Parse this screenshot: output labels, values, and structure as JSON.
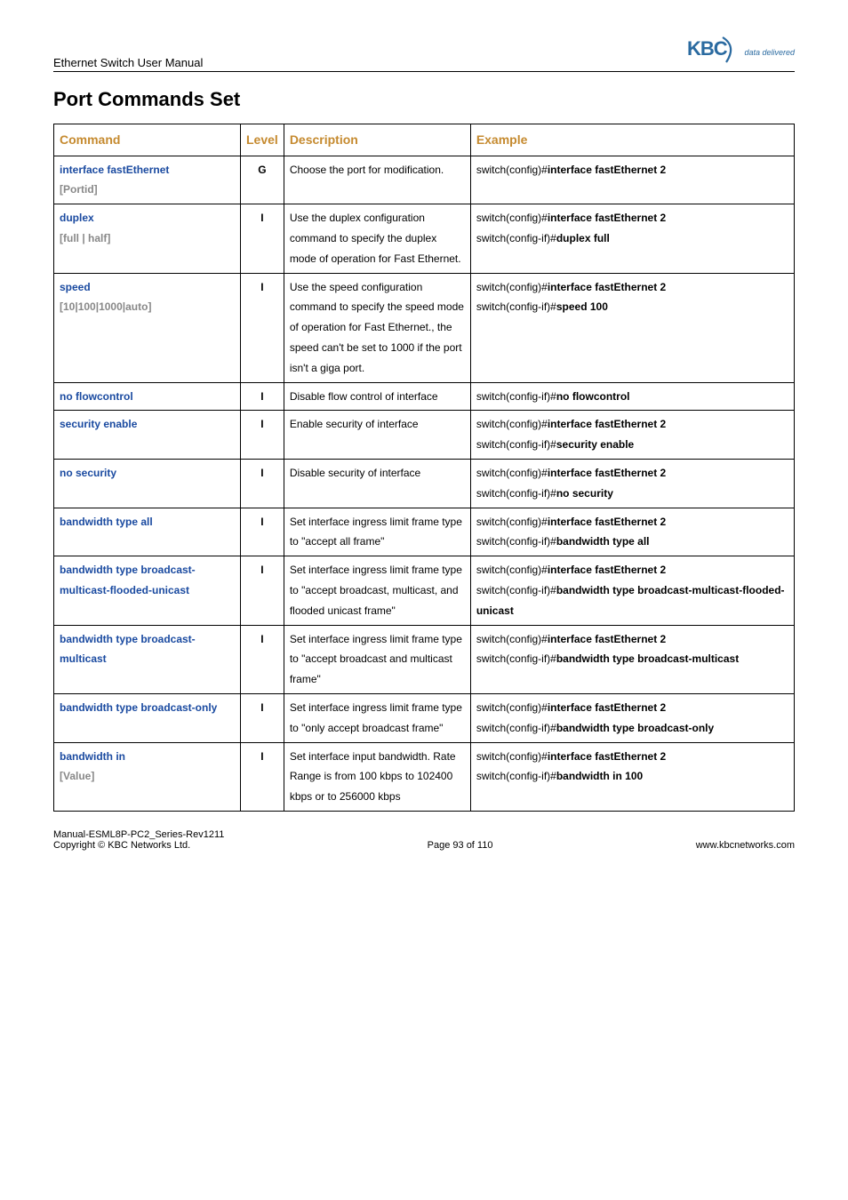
{
  "header": {
    "doc_title": "Ethernet Switch User Manual",
    "logo_tagline": "data delivered"
  },
  "section_title": "Port Commands Set",
  "table": {
    "headers": {
      "command": "Command",
      "level": "Level",
      "description": "Description",
      "example": "Example"
    },
    "rows": [
      {
        "cmd_main": "interface fastEthernet",
        "cmd_sub": "[Portid]",
        "level": "G",
        "desc": "Choose the port for modification.",
        "ex_lines": [
          {
            "pfx": "switch(config)#",
            "bold": "interface fastEthernet 2"
          }
        ]
      },
      {
        "cmd_main": "duplex",
        "cmd_sub": "[full | half]",
        "level": "I",
        "desc": "Use the duplex configuration command to specify the duplex mode of operation for Fast Ethernet.",
        "ex_lines": [
          {
            "pfx": "switch(config)#",
            "bold": "interface fastEthernet 2"
          },
          {
            "pfx": "switch(config-if)#",
            "bold": "duplex full"
          }
        ]
      },
      {
        "cmd_main": "speed",
        "cmd_sub": "[10|100|1000|auto]",
        "level": "I",
        "desc": "Use the speed configuration command to specify the speed mode of operation for Fast Ethernet., the speed can't be set to 1000 if the port isn't a giga port.",
        "ex_lines": [
          {
            "pfx": "switch(config)#",
            "bold": "interface fastEthernet 2"
          },
          {
            "pfx": "switch(config-if)#",
            "bold": "speed 100"
          }
        ]
      },
      {
        "cmd_main": "no flowcontrol",
        "cmd_sub": "",
        "level": "I",
        "desc": "Disable flow control of interface",
        "ex_lines": [
          {
            "pfx": "switch(config-if)#",
            "bold": "no flowcontrol"
          }
        ]
      },
      {
        "cmd_main": "security enable",
        "cmd_sub": "",
        "level": "I",
        "desc": "Enable security of interface",
        "ex_lines": [
          {
            "pfx": "switch(config)#",
            "bold": "interface fastEthernet 2"
          },
          {
            "pfx": "switch(config-if)#",
            "bold": "security enable"
          }
        ]
      },
      {
        "cmd_main": "no security",
        "cmd_sub": "",
        "level": "I",
        "desc": "Disable security of interface",
        "ex_lines": [
          {
            "pfx": "switch(config)#",
            "bold": "interface fastEthernet 2"
          },
          {
            "pfx": "switch(config-if)#",
            "bold": "no security"
          }
        ]
      },
      {
        "cmd_main": "bandwidth type all",
        "cmd_sub": "",
        "level": "I",
        "desc": "Set interface ingress limit frame type to \"accept all frame\"",
        "ex_lines": [
          {
            "pfx": "switch(config)#",
            "bold": "interface fastEthernet 2"
          },
          {
            "pfx": "switch(config-if)#",
            "bold": "bandwidth type all"
          }
        ]
      },
      {
        "cmd_main": "bandwidth type broadcast-multicast-flooded-unicast",
        "cmd_sub": "",
        "level": "I",
        "desc": "Set interface ingress limit frame type to \"accept broadcast, multicast, and flooded unicast frame\"",
        "ex_lines": [
          {
            "pfx": "switch(config)#",
            "bold": "interface fastEthernet 2"
          },
          {
            "pfx": "switch(config-if)#",
            "bold": "bandwidth type broadcast-multicast-flooded-unicast"
          }
        ]
      },
      {
        "cmd_main": "bandwidth type broadcast-multicast",
        "cmd_sub": "",
        "level": "I",
        "desc": "Set interface ingress limit frame type to \"accept broadcast and multicast frame\"",
        "ex_lines": [
          {
            "pfx": "switch(config)#",
            "bold": "interface fastEthernet 2"
          },
          {
            "pfx": "switch(config-if)#",
            "bold": "bandwidth type broadcast-multicast"
          }
        ]
      },
      {
        "cmd_main": "bandwidth type broadcast-only",
        "cmd_sub": "",
        "level": "I",
        "desc": "Set interface ingress limit frame type to \"only accept broadcast frame\"",
        "ex_lines": [
          {
            "pfx": "switch(config)#",
            "bold": "interface fastEthernet 2"
          },
          {
            "pfx": "switch(config-if)#",
            "bold": "bandwidth type broadcast-only"
          }
        ]
      },
      {
        "cmd_main": "bandwidth in",
        "cmd_sub": "[Value]",
        "level": "I",
        "desc": "Set interface input bandwidth. Rate Range is from 100 kbps to 102400 kbps or to 256000 kbps",
        "ex_lines": [
          {
            "pfx": "switch(config)#",
            "bold": "interface fastEthernet 2"
          },
          {
            "pfx": "switch(config-if)#",
            "bold": "bandwidth in 100"
          }
        ]
      }
    ]
  },
  "footer": {
    "left_line1": "Manual-ESML8P-PC2_Series-Rev1211",
    "left_line2": "Copyright © KBC Networks Ltd.",
    "center": "Page 93 of 110",
    "right": "www.kbcnetworks.com"
  }
}
